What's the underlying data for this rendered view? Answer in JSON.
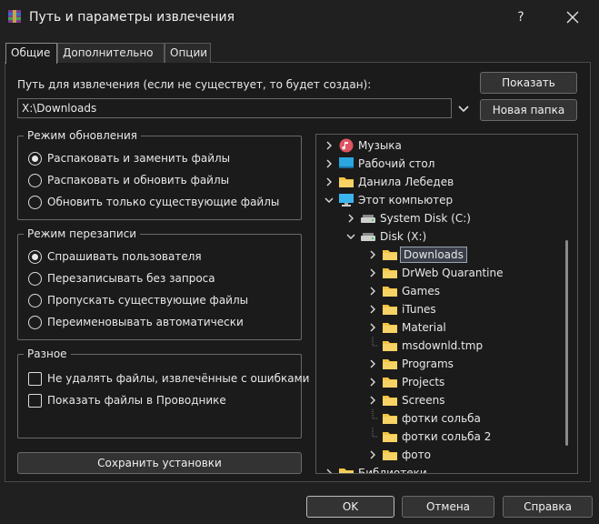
{
  "window": {
    "title": "Путь и параметры извлечения",
    "help_glyph": "?",
    "close_icon": "close-icon",
    "app_icon": "winrar-icon"
  },
  "tabs": [
    {
      "label": "Общие",
      "active": true
    },
    {
      "label": "Дополнительно",
      "active": false
    },
    {
      "label": "Опции",
      "active": false
    }
  ],
  "path": {
    "label": "Путь для извлечения (если не существует, то будет создан):",
    "value": "X:\\Downloads"
  },
  "buttons": {
    "show": "Показать",
    "new_folder": "Новая папка",
    "save": "Сохранить установки",
    "ok": "OK",
    "cancel": "Отмена",
    "help": "Справка"
  },
  "update_mode": {
    "title": "Режим обновления",
    "options": [
      {
        "label": "Распаковать и заменить файлы",
        "checked": true
      },
      {
        "label": "Распаковать и обновить файлы",
        "checked": false
      },
      {
        "label": "Обновить только существующие файлы",
        "checked": false
      }
    ]
  },
  "overwrite_mode": {
    "title": "Режим перезаписи",
    "options": [
      {
        "label": "Спрашивать пользователя",
        "checked": true
      },
      {
        "label": "Перезаписывать без запроса",
        "checked": false
      },
      {
        "label": "Пропускать существующие файлы",
        "checked": false
      },
      {
        "label": "Переименовывать автоматически",
        "checked": false
      }
    ]
  },
  "misc": {
    "title": "Разное",
    "options": [
      {
        "label": "Не удалять файлы, извлечённые с ошибками",
        "checked": false
      },
      {
        "label": "Показать файлы в Проводнике",
        "checked": false
      }
    ]
  },
  "tree": {
    "items": [
      {
        "label": "Музыка",
        "level": 0,
        "expander": "collapsed",
        "icon": "music-icon"
      },
      {
        "label": "Рабочий стол",
        "level": 0,
        "expander": "collapsed",
        "icon": "desktop-icon"
      },
      {
        "label": "Данила Лебедев",
        "level": 0,
        "expander": "collapsed",
        "icon": "folder-icon"
      },
      {
        "label": "Этот компьютер",
        "level": 0,
        "expander": "expanded",
        "icon": "computer-icon"
      },
      {
        "label": "System Disk (C:)",
        "level": 1,
        "expander": "collapsed",
        "icon": "drive-icon"
      },
      {
        "label": "Disk (X:)",
        "level": 1,
        "expander": "expanded",
        "icon": "drive-icon"
      },
      {
        "label": "Downloads",
        "level": 2,
        "expander": "collapsed",
        "icon": "folder-icon",
        "selected": true
      },
      {
        "label": "DrWeb Quarantine",
        "level": 2,
        "expander": "collapsed",
        "icon": "folder-icon"
      },
      {
        "label": "Games",
        "level": 2,
        "expander": "collapsed",
        "icon": "folder-icon"
      },
      {
        "label": "iTunes",
        "level": 2,
        "expander": "collapsed",
        "icon": "folder-icon"
      },
      {
        "label": "Material",
        "level": 2,
        "expander": "collapsed",
        "icon": "folder-icon"
      },
      {
        "label": "msdownld.tmp",
        "level": 2,
        "expander": "none",
        "icon": "folder-icon"
      },
      {
        "label": "Programs",
        "level": 2,
        "expander": "collapsed",
        "icon": "folder-icon"
      },
      {
        "label": "Projects",
        "level": 2,
        "expander": "collapsed",
        "icon": "folder-icon"
      },
      {
        "label": "Screens",
        "level": 2,
        "expander": "collapsed",
        "icon": "folder-icon"
      },
      {
        "label": "фотки сольба",
        "level": 2,
        "expander": "none",
        "icon": "folder-icon"
      },
      {
        "label": "фотки сольба 2",
        "level": 2,
        "expander": "none",
        "icon": "folder-icon"
      },
      {
        "label": "фото",
        "level": 2,
        "expander": "collapsed",
        "icon": "folder-icon"
      },
      {
        "label": "Библиотеки",
        "level": 0,
        "expander": "collapsed",
        "icon": "folder-icon"
      }
    ]
  },
  "colors": {
    "background": "#202020",
    "panel": "#1b1b1b",
    "folder": "#f4c542",
    "selection": "#3a3e48",
    "music": "#e05562",
    "desktop": "#2aa6e0"
  }
}
